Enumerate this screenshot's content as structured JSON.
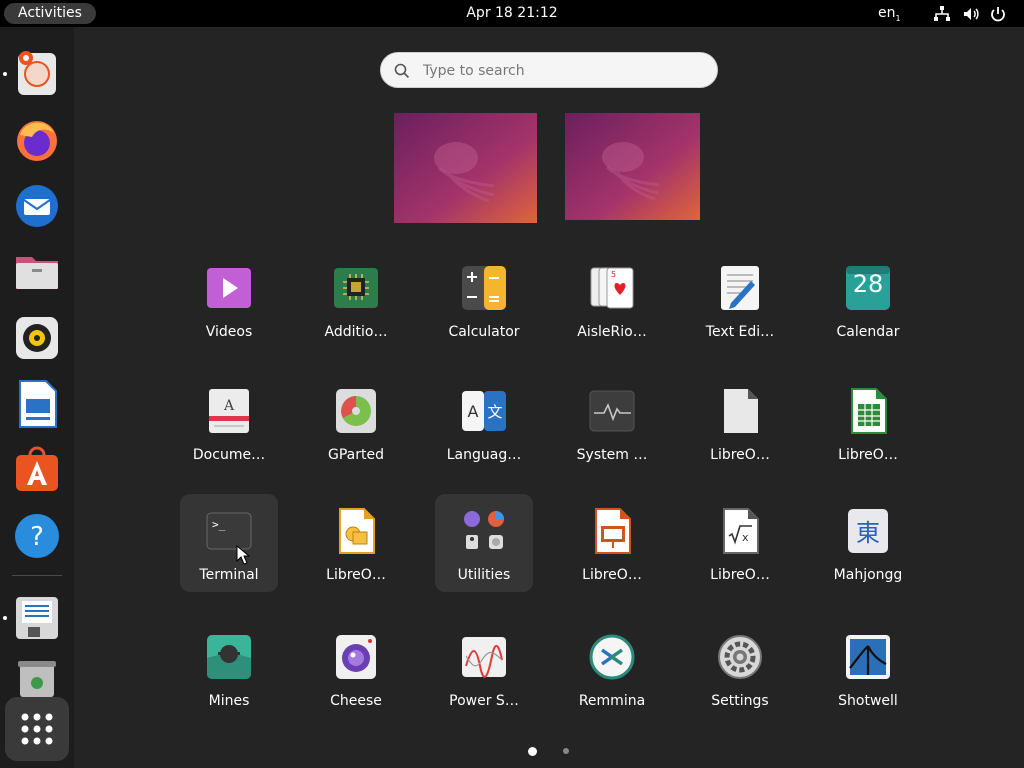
{
  "topbar": {
    "activities_label": "Activities",
    "clock": "Apr 18  21:12",
    "language": "en",
    "language_sub": "1"
  },
  "search": {
    "placeholder": "Type to search",
    "value": ""
  },
  "apps": [
    {
      "label": "Videos",
      "icon": "videos-icon"
    },
    {
      "label": "Additio…",
      "icon": "additional-drivers-icon"
    },
    {
      "label": "Calculator",
      "icon": "calculator-icon"
    },
    {
      "label": "AisleRio…",
      "icon": "aisleriot-icon"
    },
    {
      "label": "Text Edi…",
      "icon": "text-editor-icon"
    },
    {
      "label": "Calendar",
      "icon": "calendar-icon",
      "badge": "28"
    },
    {
      "label": "Docume…",
      "icon": "document-viewer-icon"
    },
    {
      "label": "GParted",
      "icon": "gparted-icon"
    },
    {
      "label": "Languag…",
      "icon": "language-support-icon"
    },
    {
      "label": "System …",
      "icon": "system-monitor-icon"
    },
    {
      "label": "LibreO…",
      "icon": "libreoffice-icon"
    },
    {
      "label": "LibreO…",
      "icon": "libreoffice-calc-icon"
    },
    {
      "label": "Terminal",
      "icon": "terminal-icon"
    },
    {
      "label": "LibreO…",
      "icon": "libreoffice-draw-icon"
    },
    {
      "label": "Utilities",
      "icon": "utilities-folder-icon"
    },
    {
      "label": "LibreO…",
      "icon": "libreoffice-impress-icon"
    },
    {
      "label": "LibreO…",
      "icon": "libreoffice-math-icon"
    },
    {
      "label": "Mahjongg",
      "icon": "mahjongg-icon",
      "glyph": "東"
    },
    {
      "label": "Mines",
      "icon": "mines-icon"
    },
    {
      "label": "Cheese",
      "icon": "cheese-icon"
    },
    {
      "label": "Power S…",
      "icon": "power-statistics-icon"
    },
    {
      "label": "Remmina",
      "icon": "remmina-icon"
    },
    {
      "label": "Settings",
      "icon": "settings-icon"
    },
    {
      "label": "Shotwell",
      "icon": "shotwell-icon"
    }
  ],
  "dock": [
    "ubuntu-installer-icon",
    "firefox-icon",
    "thunderbird-icon",
    "files-icon",
    "rhythmbox-icon",
    "libreoffice-writer-icon",
    "app-center-icon",
    "help-icon",
    "save-disk-icon",
    "trash-icon",
    "show-apps-icon"
  ],
  "colors": {
    "panel": "#000000",
    "background": "#242424",
    "dock": "#1d1d1d",
    "accent": "#e95420"
  },
  "pager": {
    "pages": 2,
    "current": 1
  }
}
